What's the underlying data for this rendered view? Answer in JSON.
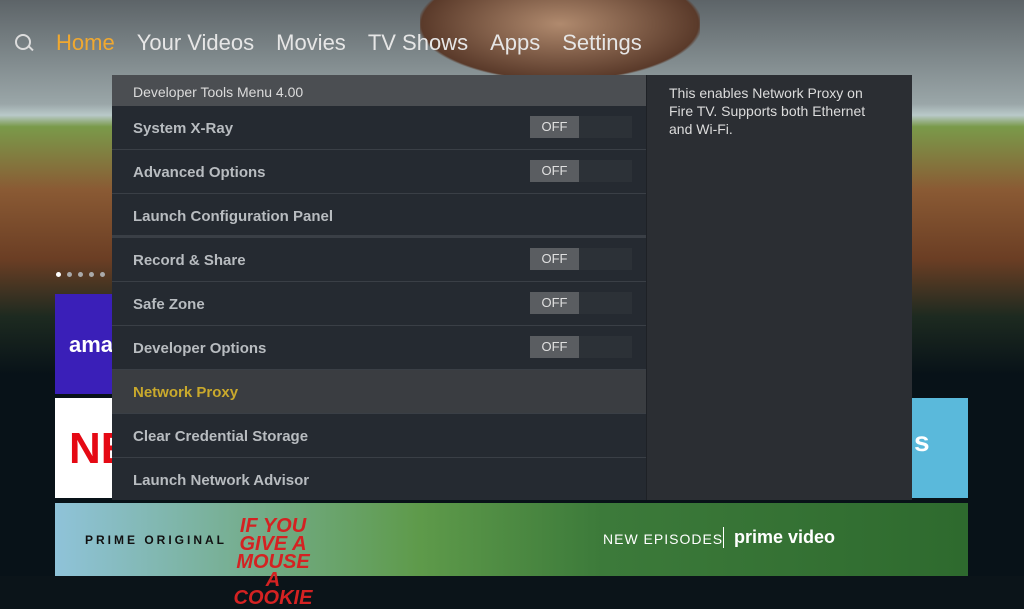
{
  "nav": {
    "items": [
      {
        "label": "Home",
        "active": true
      },
      {
        "label": "Your Videos"
      },
      {
        "label": "Movies"
      },
      {
        "label": "TV Shows"
      },
      {
        "label": "Apps"
      },
      {
        "label": "Settings"
      }
    ]
  },
  "menu": {
    "title": "Developer Tools Menu 4.00",
    "items": [
      {
        "label": "System X-Ray",
        "toggle": "OFF"
      },
      {
        "label": "Advanced Options",
        "toggle": "OFF"
      },
      {
        "label": "Launch Configuration Panel"
      },
      {
        "label": "Record & Share",
        "toggle": "OFF"
      },
      {
        "label": "Safe Zone",
        "toggle": "OFF"
      },
      {
        "label": "Developer Options",
        "toggle": "OFF"
      },
      {
        "label": "Network Proxy",
        "selected": true
      },
      {
        "label": "Clear Credential Storage"
      },
      {
        "label": "Launch Network Advisor"
      }
    ]
  },
  "description": "This enables Network Proxy on Fire TV. Supports both Ethernet and Wi-Fi.",
  "tiles": {
    "amazon": "ama",
    "netflix": "NE",
    "blue": "s"
  },
  "banner": {
    "prime_original": "PRIME ORIGINAL",
    "show": "IF YOU GIVE A MOUSE A COOKIE",
    "new_episodes": "NEW EPISODES",
    "brand": "prime video"
  },
  "colors": {
    "accent": "#f0a830",
    "selected_text": "#c9a92c"
  }
}
